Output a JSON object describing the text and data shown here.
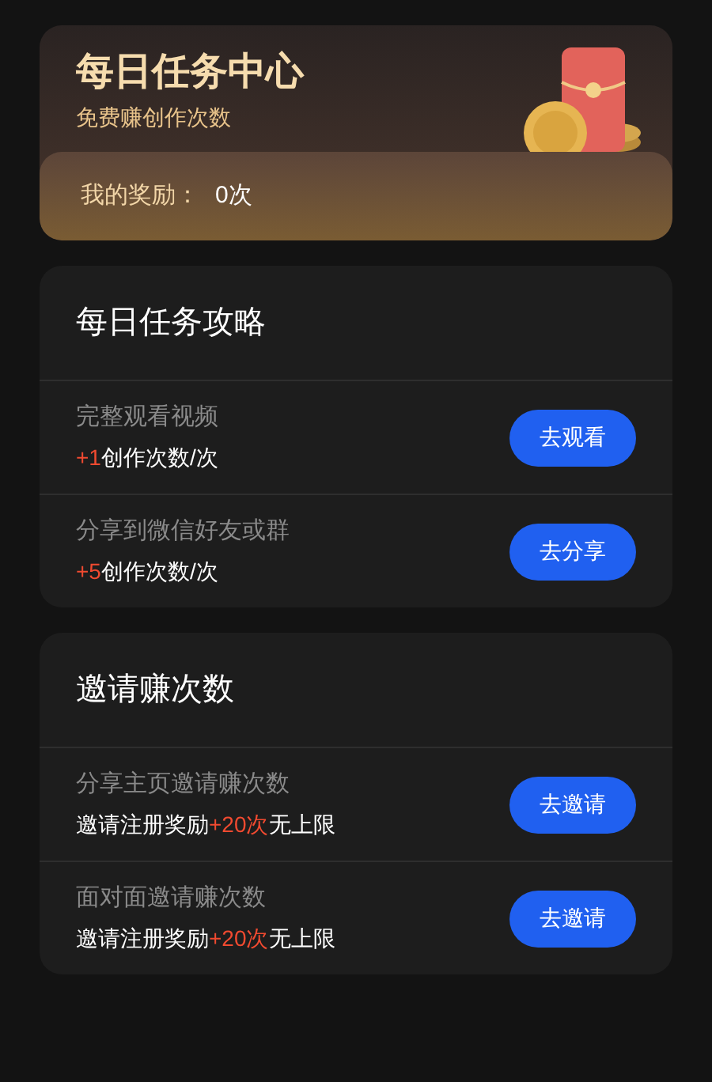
{
  "header": {
    "title": "每日任务中心",
    "subtitle": "免费赚创作次数",
    "reward_label": "我的奖励：",
    "reward_value": "0次"
  },
  "sections": [
    {
      "title": "每日任务攻略",
      "tasks": [
        {
          "name": "完整观看视频",
          "reward": [
            {
              "text": "+1",
              "highlight": true
            },
            {
              "text": "创作次数/次",
              "highlight": false
            }
          ],
          "button": "去观看"
        },
        {
          "name": "分享到微信好友或群",
          "reward": [
            {
              "text": "+5",
              "highlight": true
            },
            {
              "text": "创作次数/次",
              "highlight": false
            }
          ],
          "button": "去分享"
        }
      ]
    },
    {
      "title": "邀请赚次数",
      "tasks": [
        {
          "name": "分享主页邀请赚次数",
          "reward": [
            {
              "text": "邀请注册奖励",
              "highlight": false
            },
            {
              "text": "+20次",
              "highlight": true
            },
            {
              "text": "无上限",
              "highlight": false
            }
          ],
          "button": "去邀请"
        },
        {
          "name": "面对面邀请赚次数",
          "reward": [
            {
              "text": "邀请注册奖励",
              "highlight": false
            },
            {
              "text": "+20次",
              "highlight": true
            },
            {
              "text": "无上限",
              "highlight": false
            }
          ],
          "button": "去邀请"
        }
      ]
    }
  ]
}
